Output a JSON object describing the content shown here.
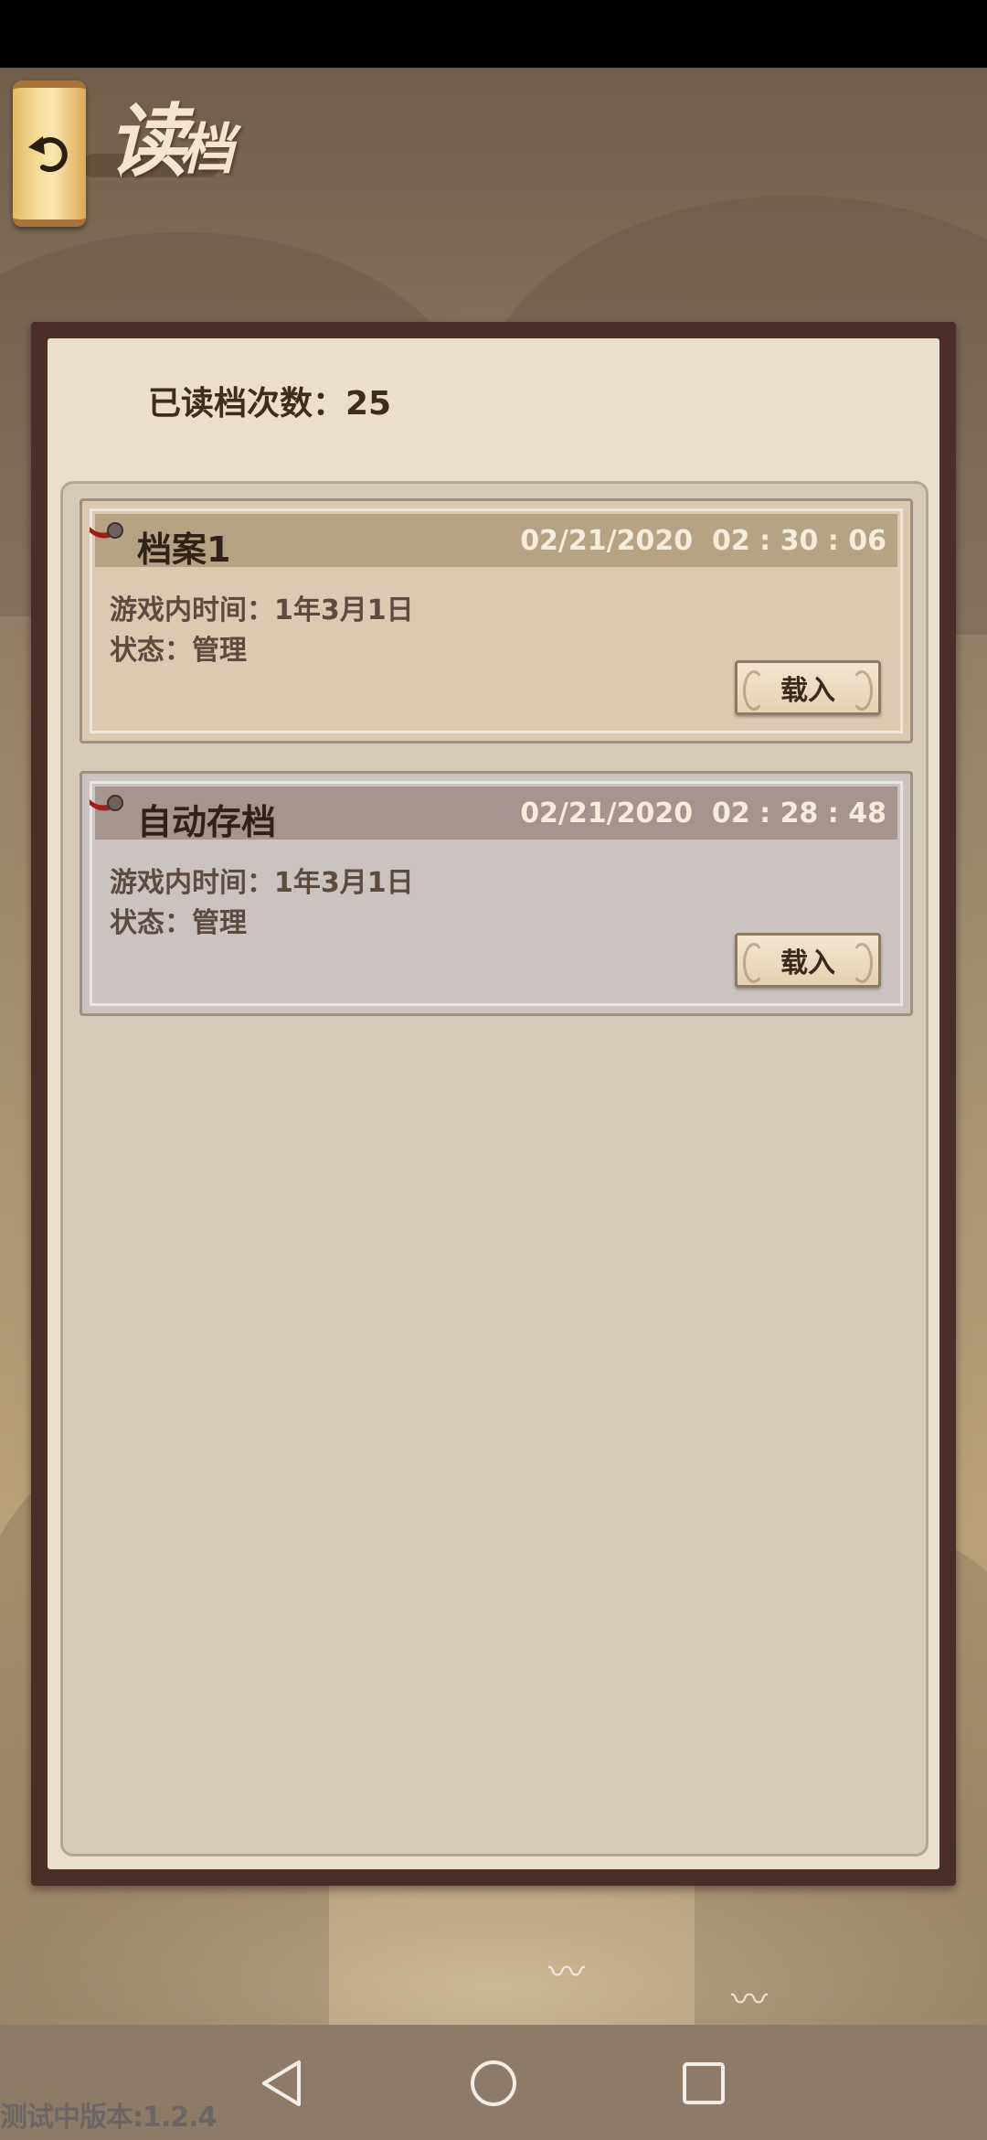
{
  "header": {
    "title_main": "读",
    "title_small": "档",
    "back_icon": "back-arrow-icon"
  },
  "panel": {
    "read_count_label": "已读档次数：25"
  },
  "saves": [
    {
      "name": "档案1",
      "timestamp": "02/21/2020  02 : 30 : 06",
      "game_time": "游戏内时间：1年3月1日",
      "status": "状态：管理",
      "load_label": "载入"
    },
    {
      "name": "自动存档",
      "timestamp": "02/21/2020  02 : 28 : 48",
      "game_time": "游戏内时间：1年3月1日",
      "status": "状态：管理",
      "load_label": "载入"
    }
  ],
  "footer": {
    "version": "测试中版本:1.2.4"
  },
  "colors": {
    "frame": "#4a2e27",
    "panel": "#e9dfcc",
    "card_primary": "#dccab0",
    "card_auto": "#cbc3c0"
  }
}
